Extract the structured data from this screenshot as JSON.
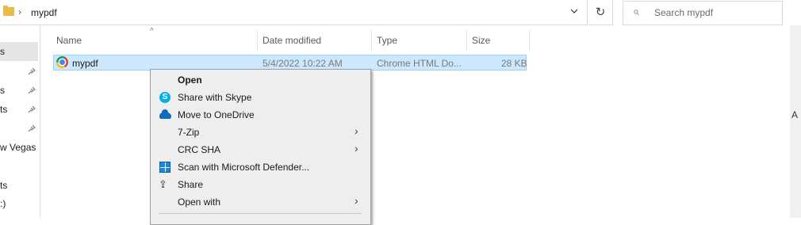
{
  "address_bar": {
    "crumb": "mypdf",
    "separator": "›",
    "dropdown_icon": "chevron-down-icon",
    "refresh_glyph": "↻"
  },
  "search": {
    "placeholder": "Search mypdf",
    "icon": "⌕"
  },
  "nav": {
    "items": [
      {
        "label": "s",
        "pinned": false,
        "selected": true
      },
      {
        "label": "s",
        "pinned": true
      },
      {
        "label": "ts",
        "pinned": true
      },
      {
        "label": "",
        "pinned": true
      },
      {
        "label": "w Vegas",
        "pinned": false
      },
      {
        "label": "ts",
        "pinned": false
      },
      {
        "label": ":)",
        "pinned": false
      }
    ],
    "pin_glyph": "📌"
  },
  "columns": {
    "name": "Name",
    "date": "Date modified",
    "type": "Type",
    "size": "Size",
    "sort_caret": "^"
  },
  "file": {
    "name": "mypdf",
    "date": "5/4/2022 10:22 AM",
    "type": "Chrome HTML Do...",
    "size": "28 KB"
  },
  "context_menu": {
    "items": [
      {
        "label": "Open",
        "bold": true
      },
      {
        "label": "Share with Skype",
        "icon": "skype-icon",
        "icon_text": "S"
      },
      {
        "label": "Move to OneDrive",
        "icon": "onedrive-icon"
      },
      {
        "label": "7-Zip",
        "submenu": true
      },
      {
        "label": "CRC SHA",
        "submenu": true
      },
      {
        "label": "Scan with Microsoft Defender...",
        "icon": "defender-icon"
      },
      {
        "label": "Share",
        "icon": "share-icon",
        "icon_text": "⇪"
      },
      {
        "label": "Open with",
        "submenu": true
      }
    ],
    "submenu_arrow": "›"
  },
  "right_pane_edge_text": "A"
}
